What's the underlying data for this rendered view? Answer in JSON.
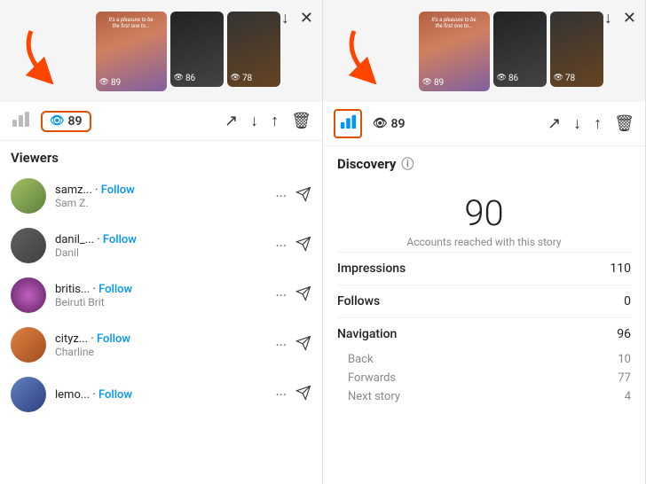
{
  "left_panel": {
    "stats_bar": {
      "views_count": "89",
      "eye_icon": "eye-icon",
      "bar_chart_icon": "bar-chart-icon"
    },
    "viewers_header": "Viewers",
    "viewers": [
      {
        "id": 1,
        "username": "samz...",
        "follow_label": "Follow",
        "handle": "Sam Z.",
        "avatar_class": "av1"
      },
      {
        "id": 2,
        "username": "danil_...",
        "follow_label": "Follow",
        "handle": "Danil",
        "avatar_class": "av2"
      },
      {
        "id": 3,
        "username": "britis...",
        "follow_label": "Follow",
        "handle": "Beiruti Brit",
        "avatar_class": "av3"
      },
      {
        "id": 4,
        "username": "cityz...",
        "follow_label": "Follow",
        "handle": "Charline",
        "avatar_class": "av4"
      },
      {
        "id": 5,
        "username": "lemo...",
        "follow_label": "Follow",
        "handle": "",
        "avatar_class": "av5"
      }
    ],
    "actions": {
      "trend_icon": "↗",
      "download_icon": "↓",
      "share_icon": "↑",
      "delete_icon": "🗑"
    }
  },
  "right_panel": {
    "discovery_header": "Discovery",
    "reach_count": "90",
    "reach_label": "Accounts reached with this story",
    "metrics": [
      {
        "name": "Impressions",
        "value": "110"
      },
      {
        "name": "Follows",
        "value": "0"
      },
      {
        "name": "Navigation",
        "value": "96",
        "sub_metrics": [
          {
            "name": "Back",
            "value": "10"
          },
          {
            "name": "Forwards",
            "value": "77"
          },
          {
            "name": "Next story",
            "value": "4"
          }
        ]
      }
    ]
  },
  "story_preview": {
    "views_89": "89",
    "views_86": "86",
    "views_78": "78"
  },
  "top_actions": {
    "download_label": "↓",
    "close_label": "✕"
  }
}
